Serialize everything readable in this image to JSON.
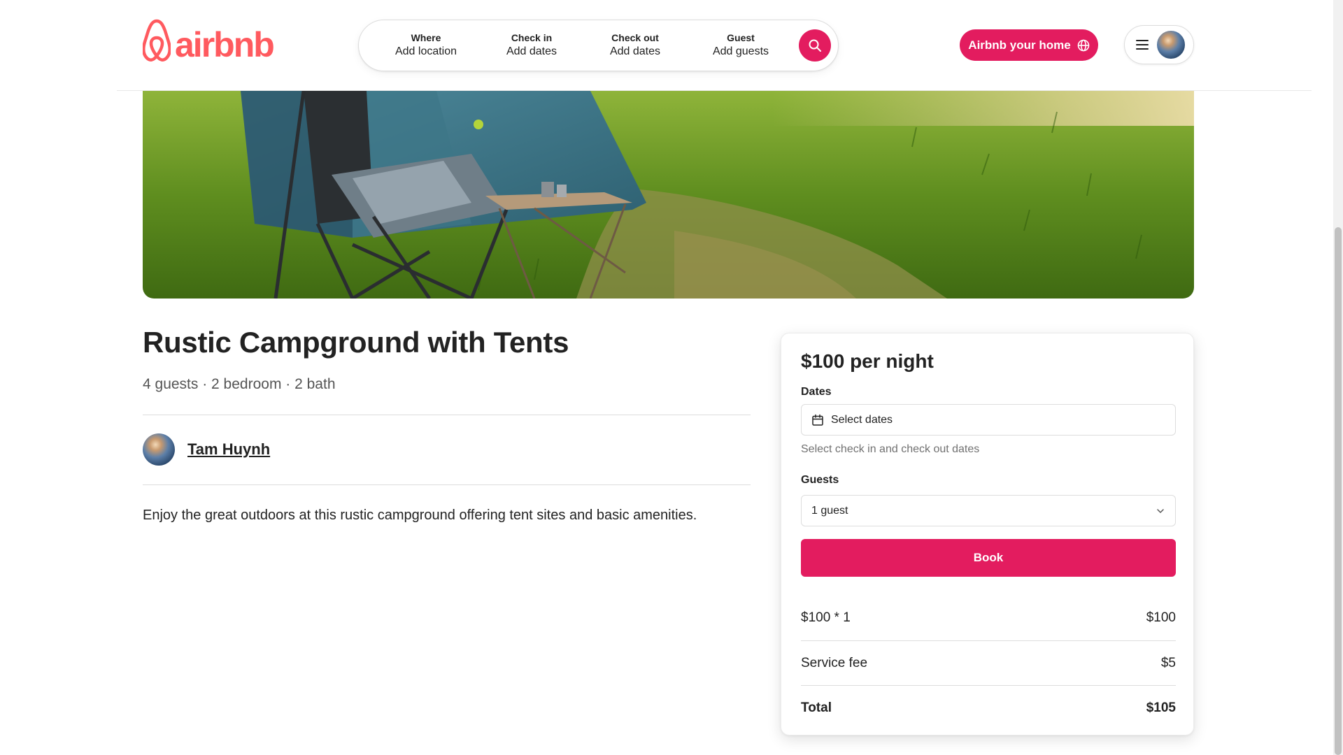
{
  "header": {
    "logo_text": "airbnb",
    "search": {
      "where": {
        "label": "Where",
        "value": "Add location"
      },
      "check_in": {
        "label": "Check in",
        "value": "Add dates"
      },
      "check_out": {
        "label": "Check out",
        "value": "Add dates"
      },
      "guest": {
        "label": "Guest",
        "value": "Add guests"
      }
    },
    "host_button_label": "Airbnb your home"
  },
  "listing": {
    "title": "Rustic Campground with Tents",
    "subtitle": "4 guests · 2 bedroom · 2 bath",
    "host_name": "Tam Huynh",
    "description": "Enjoy the great outdoors at this rustic campground offering tent sites and basic amenities."
  },
  "booking": {
    "price_per_night": "$100 per night",
    "dates_label": "Dates",
    "dates_placeholder": "Select dates",
    "dates_hint": "Select check in and check out dates",
    "guests_label": "Guests",
    "guests_value": "1 guest",
    "book_label": "Book",
    "line_items": [
      {
        "label": "$100 * 1",
        "amount": "$100"
      },
      {
        "label": "Service fee",
        "amount": "$5"
      }
    ],
    "total": {
      "label": "Total",
      "amount": "$105"
    }
  },
  "colors": {
    "brand": "#ff5a5f",
    "accent": "#e31c5f"
  }
}
